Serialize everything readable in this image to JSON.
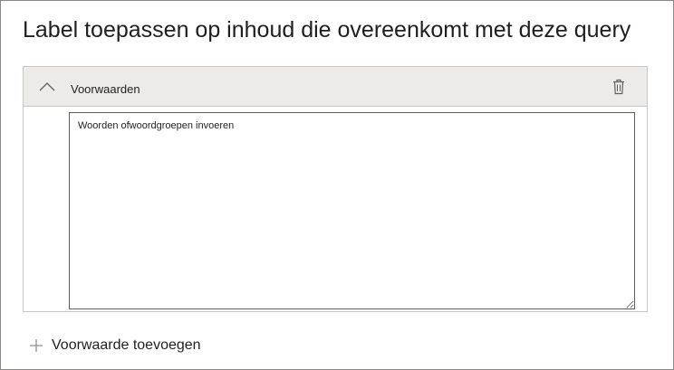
{
  "dialog": {
    "title": "Label toepassen op inhoud die overeenkomt met deze query"
  },
  "conditions": {
    "header_label": "Voorwaarden",
    "collapse_icon": "chevron-up-icon",
    "delete_icon": "trash-icon",
    "query_input": {
      "value": "",
      "placeholder": "Woorden ofwoordgroepen invoeren"
    }
  },
  "add_condition": {
    "label": "Voorwaarde toevoegen",
    "icon": "plus-icon"
  },
  "colors": {
    "header_background": "#edebe9",
    "border": "#c8c6c4",
    "text": "#201f1e"
  }
}
